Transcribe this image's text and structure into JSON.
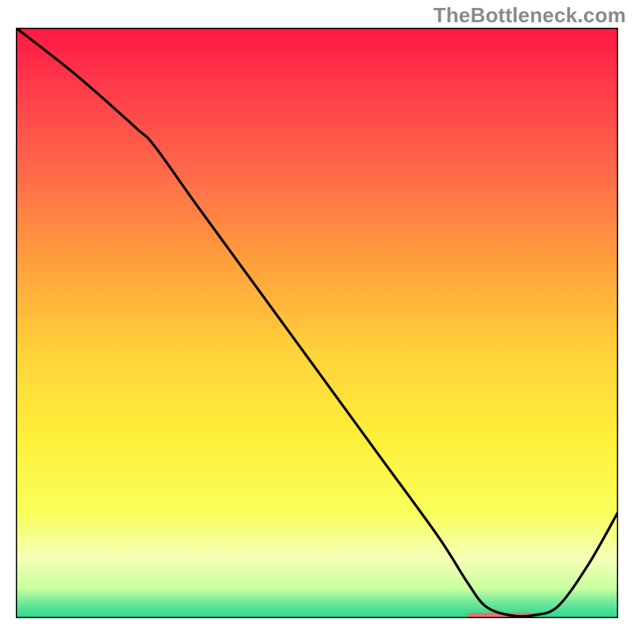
{
  "watermark": "TheBottleneck.com",
  "chart_data": {
    "type": "line",
    "title": "",
    "xlabel": "",
    "ylabel": "",
    "xlim": [
      0,
      100
    ],
    "ylim": [
      0,
      100
    ],
    "grid": false,
    "legend": false,
    "series": [
      {
        "name": "curve",
        "x": [
          0,
          10,
          20,
          23,
          30,
          40,
          50,
          60,
          70,
          75,
          78,
          82,
          86,
          90,
          95,
          100
        ],
        "y": [
          100,
          92,
          83,
          80,
          70,
          56,
          42,
          28,
          14,
          6,
          2,
          0.5,
          0.5,
          2,
          9,
          18
        ]
      }
    ],
    "thin_band": {
      "x_start": 75,
      "x_end": 86,
      "y": 0.5,
      "color": "#e57373"
    },
    "background_gradient": {
      "stops": [
        {
          "offset": 0.0,
          "color": "#ff1744"
        },
        {
          "offset": 0.1,
          "color": "#ff3b4a"
        },
        {
          "offset": 0.25,
          "color": "#ff6b4a"
        },
        {
          "offset": 0.4,
          "color": "#ffa03c"
        },
        {
          "offset": 0.55,
          "color": "#ffd23a"
        },
        {
          "offset": 0.7,
          "color": "#fff03a"
        },
        {
          "offset": 0.82,
          "color": "#f8ff59"
        },
        {
          "offset": 0.9,
          "color": "#f5ffb8"
        },
        {
          "offset": 0.95,
          "color": "#c8ff9e"
        },
        {
          "offset": 0.975,
          "color": "#6be89a"
        },
        {
          "offset": 1.0,
          "color": "#29d68d"
        }
      ]
    }
  }
}
